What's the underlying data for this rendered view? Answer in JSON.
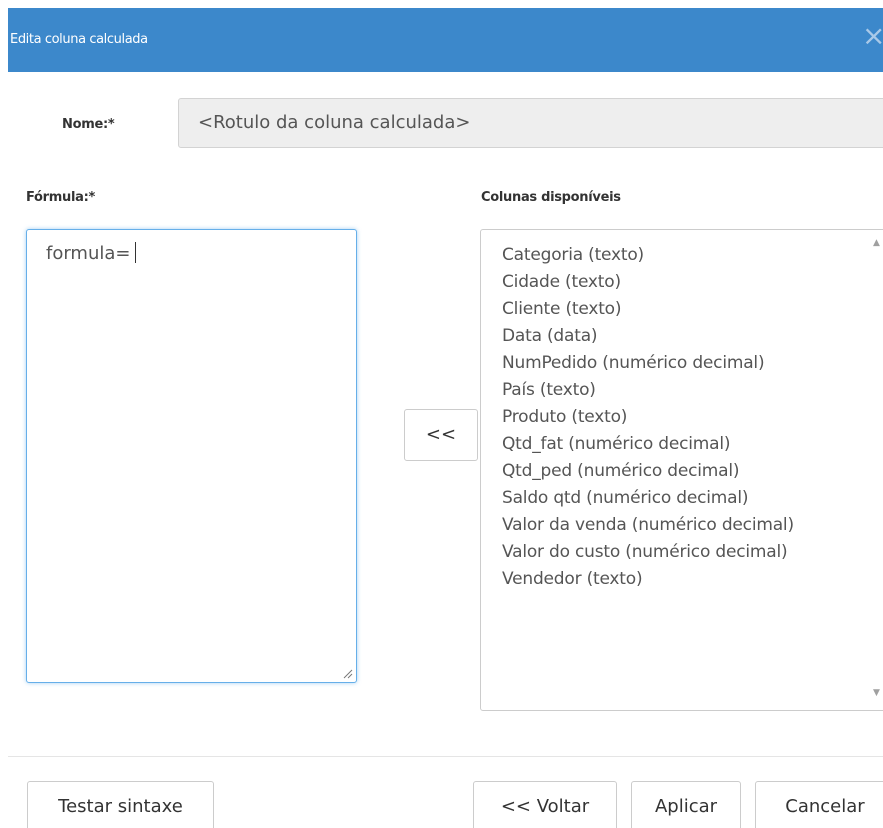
{
  "dialog": {
    "title": "Edita coluna calculada",
    "close_glyph": "×"
  },
  "name_field": {
    "label": "Nome:*",
    "value": "<Rotulo da coluna calculada>"
  },
  "formula_field": {
    "label": "Fórmula:*",
    "value": "formula="
  },
  "columns_panel": {
    "label": "Colunas disponíveis",
    "items": [
      "Categoria (texto)",
      "Cidade (texto)",
      "Cliente (texto)",
      "Data (data)",
      "NumPedido (numérico decimal)",
      "País (texto)",
      "Produto (texto)",
      "Qtd_fat (numérico decimal)",
      "Qtd_ped (numérico decimal)",
      "Saldo qtd (numérico decimal)",
      "Valor da venda (numérico decimal)",
      "Valor do custo (numérico decimal)",
      "Vendedor (texto)"
    ]
  },
  "move_button": {
    "label": "<<"
  },
  "footer": {
    "test_label": "Testar sintaxe",
    "back_label": "<< Voltar",
    "apply_label": "Aplicar",
    "cancel_label": "Cancelar"
  },
  "icons": {
    "close": "close-icon",
    "scroll_up": "scroll-up-icon",
    "scroll_down": "scroll-down-icon",
    "resize": "resize-grip-icon"
  },
  "colors": {
    "header_bg": "#3c88cb",
    "header_text": "#ffffff",
    "input_focus_border": "#66afe9"
  }
}
